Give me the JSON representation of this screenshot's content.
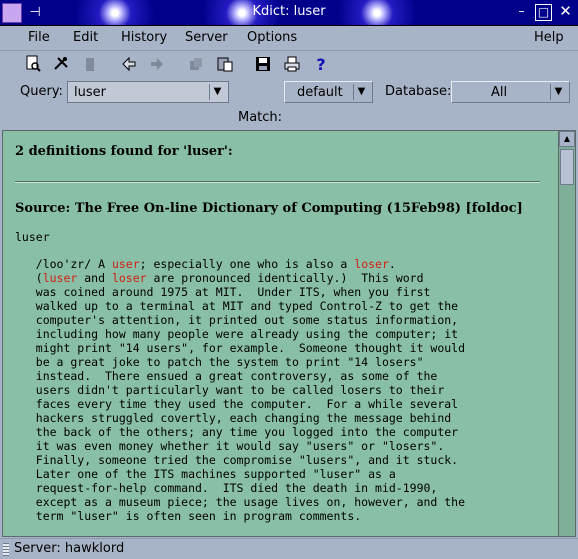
{
  "window": {
    "title": "Kdict: luser",
    "icons": [
      "dictionary-app-icon",
      "pin-icon"
    ],
    "buttons": {
      "minimize": "–",
      "maximize": "□",
      "close": "✕"
    }
  },
  "menu": [
    {
      "label": "File"
    },
    {
      "label": "Edit"
    },
    {
      "label": "History"
    },
    {
      "label": "Server"
    },
    {
      "label": "Options"
    },
    {
      "label": "Help"
    }
  ],
  "toolbar": {
    "icons": [
      "define-icon",
      "stop-icon",
      "trash-icon",
      "back-arrow-icon",
      "forward-arrow-icon",
      "copy-icon",
      "paste-icon",
      "save-icon",
      "print-icon",
      "help-icon"
    ]
  },
  "query": {
    "label": "Query:",
    "value": "luser",
    "strategy": "default",
    "database_label": "Database:",
    "database": "All",
    "match_label": "Match:"
  },
  "result": {
    "found": "2 definitions found for 'luser':",
    "source": "Source: The Free On-line Dictionary of Computing (15Feb98) [foldoc]",
    "headword": "luser",
    "lines": [
      [
        "   /loo'zr/ A ",
        {
          "ref": "user"
        },
        "; especially one who is also a ",
        {
          "ref": "loser"
        },
        "."
      ],
      [
        "   (",
        {
          "ref": "luser"
        },
        " and ",
        {
          "ref": "loser"
        },
        " are pronounced identically.)  This word"
      ],
      [
        "   was coined around 1975 at MIT.  Under ITS, when you first"
      ],
      [
        "   walked up to a terminal at MIT and typed Control-Z to get the"
      ],
      [
        "   computer's attention, it printed out some status information,"
      ],
      [
        "   including how many people were already using the computer; it"
      ],
      [
        "   might print \"14 users\", for example.  Someone thought it would"
      ],
      [
        "   be a great joke to patch the system to print \"14 losers\""
      ],
      [
        "   instead.  There ensued a great controversy, as some of the"
      ],
      [
        "   users didn't particularly want to be called losers to their"
      ],
      [
        "   faces every time they used the computer.  For a while several"
      ],
      [
        "   hackers struggled covertly, each changing the message behind"
      ],
      [
        "   the back of the others; any time you logged into the computer"
      ],
      [
        "   it was even money whether it would say \"users\" or \"losers\"."
      ],
      [
        "   Finally, someone tried the compromise \"lusers\", and it stuck."
      ],
      [
        "   Later one of the ITS machines supported \"luser\" as a"
      ],
      [
        "   request-for-help command.  ITS died the death in mid-1990,"
      ],
      [
        "   except as a museum piece; the usage lives on, however, and the"
      ],
      [
        "   term \"luser\" is often seen in program comments."
      ]
    ]
  },
  "status": {
    "text": "Server: hawklord"
  },
  "colors": {
    "view_bg": "#89bfa6",
    "link": "#d21f12",
    "title_bg": "#00008a",
    "chrome": "#a7b3c6"
  }
}
